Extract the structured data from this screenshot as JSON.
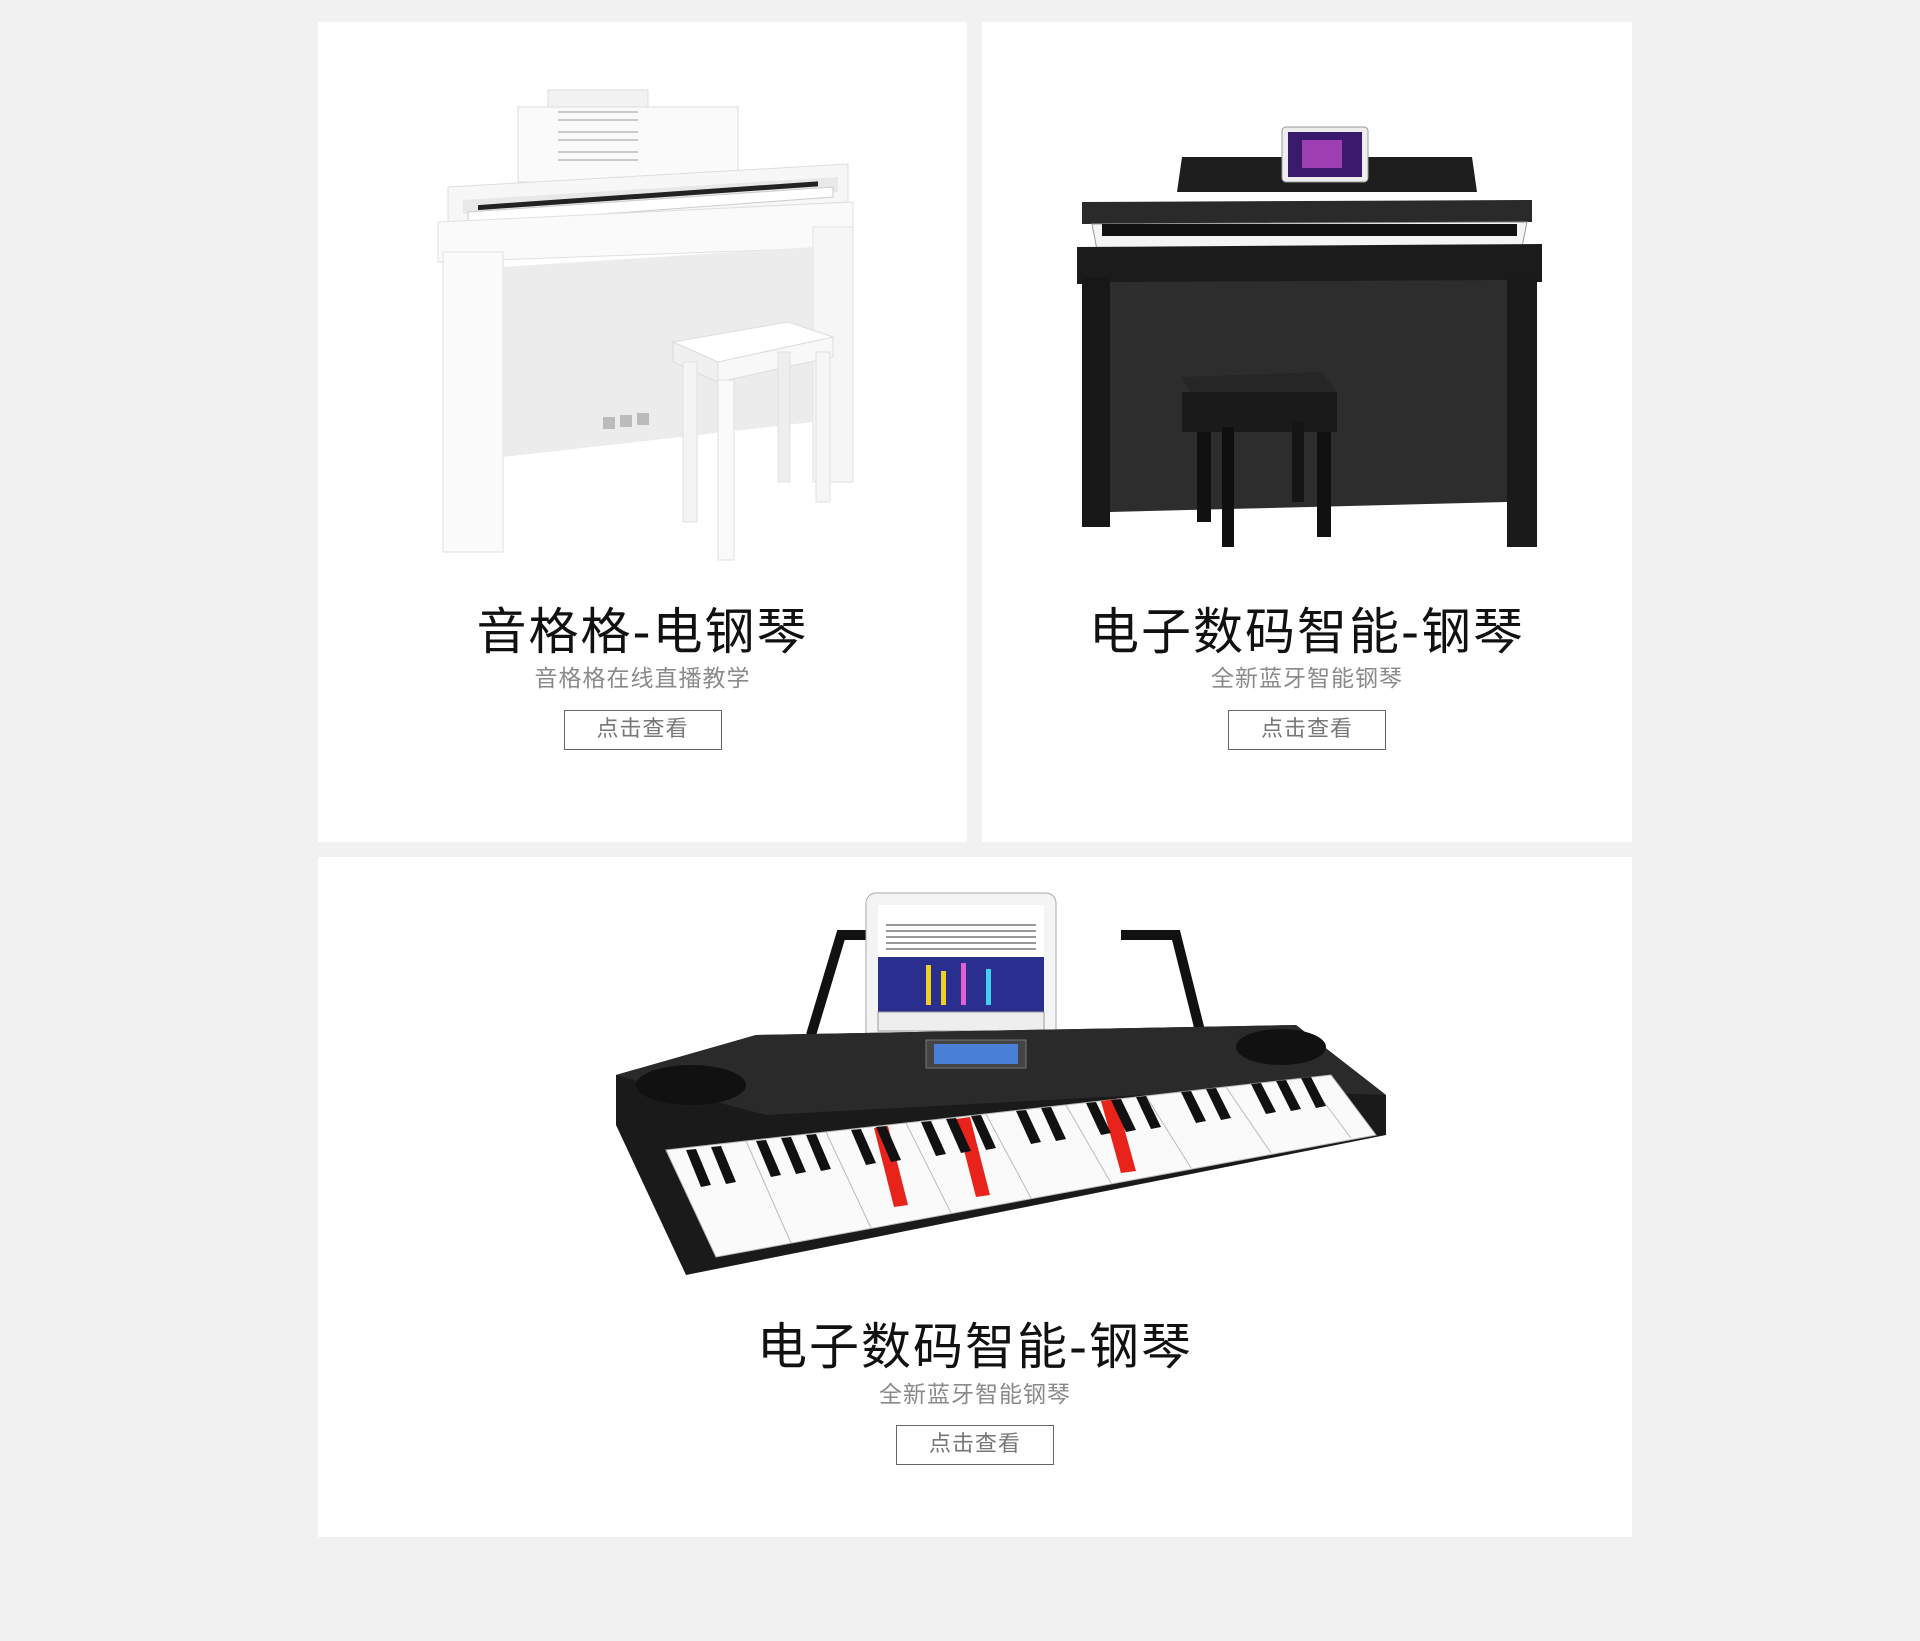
{
  "products": [
    {
      "title": "音格格-电钢琴",
      "subtitle": "音格格在线直播教学",
      "button_label": "点击查看",
      "image": "white-digital-piano-with-bench"
    },
    {
      "title": "电子数码智能-钢琴",
      "subtitle": "全新蓝牙智能钢琴",
      "button_label": "点击查看",
      "image": "black-digital-piano-with-tablet-and-bench"
    },
    {
      "title": "电子数码智能-钢琴",
      "subtitle": "全新蓝牙智能钢琴",
      "button_label": "点击查看",
      "image": "electronic-keyboard-with-tablet-stand"
    }
  ],
  "colors": {
    "page_background": "#f1f1f1",
    "card_background": "#ffffff",
    "title_text": "#111111",
    "subtitle_text": "#8a8a8a",
    "button_border": "#666666",
    "lit_key": "#e8231b"
  }
}
